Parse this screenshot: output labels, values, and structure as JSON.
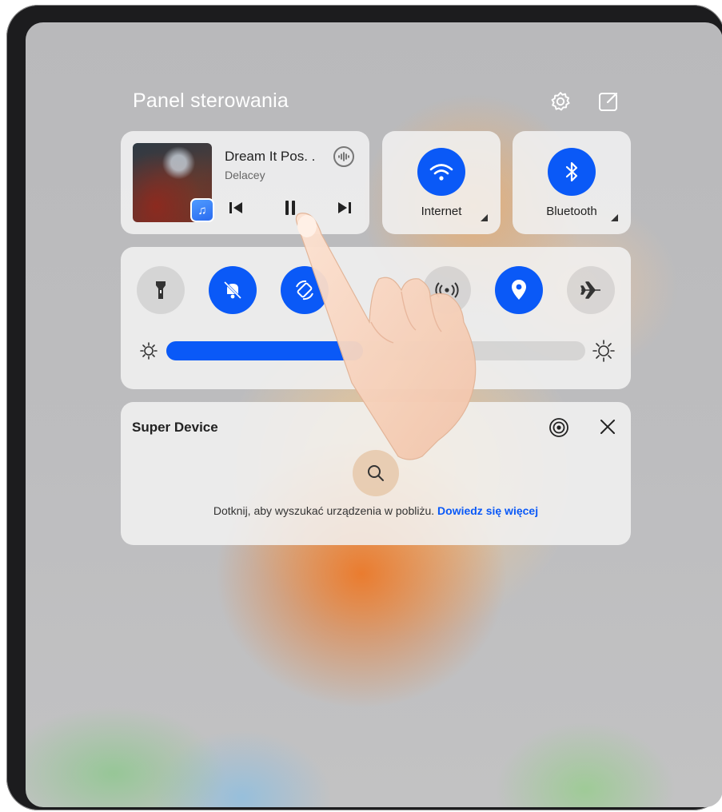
{
  "panel": {
    "title": "Panel sterowania"
  },
  "header_icons": [
    "gear-icon",
    "edit-icon"
  ],
  "media": {
    "song_title": "Dream It Pos. .",
    "artist": "Delacey",
    "controls": [
      "previous-icon",
      "play-pause-icon",
      "next-icon"
    ],
    "app_icon": "music-icon",
    "output_icon": "sound-wave-icon"
  },
  "toggles": [
    {
      "label": "Internet",
      "icon": "wifi-icon",
      "state": "on"
    },
    {
      "label": "Bluetooth",
      "icon": "bluetooth-icon",
      "state": "on"
    }
  ],
  "quick_settings": [
    {
      "icon": "flashlight-icon",
      "state": "off"
    },
    {
      "icon": "mute-bell-icon",
      "state": "on"
    },
    {
      "icon": "auto-rotate-icon",
      "state": "on"
    },
    {
      "icon": "hotspot-icon",
      "state": "off"
    },
    {
      "icon": "location-icon",
      "state": "on"
    },
    {
      "icon": "airplane-icon",
      "state": "off"
    }
  ],
  "brightness": {
    "level": 0.47,
    "icons": [
      "brightness-low-icon",
      "brightness-high-icon"
    ]
  },
  "super_device": {
    "title": "Super Device",
    "hint": "Dotknij, aby wyszukać urządzenia w pobliżu.",
    "link": "Dowiedz się więcej",
    "icons": [
      "radar-icon",
      "close-icon",
      "search-icon"
    ]
  },
  "colors": {
    "accent": "#0a59f7",
    "panel_bg": "#f2f2f2"
  }
}
